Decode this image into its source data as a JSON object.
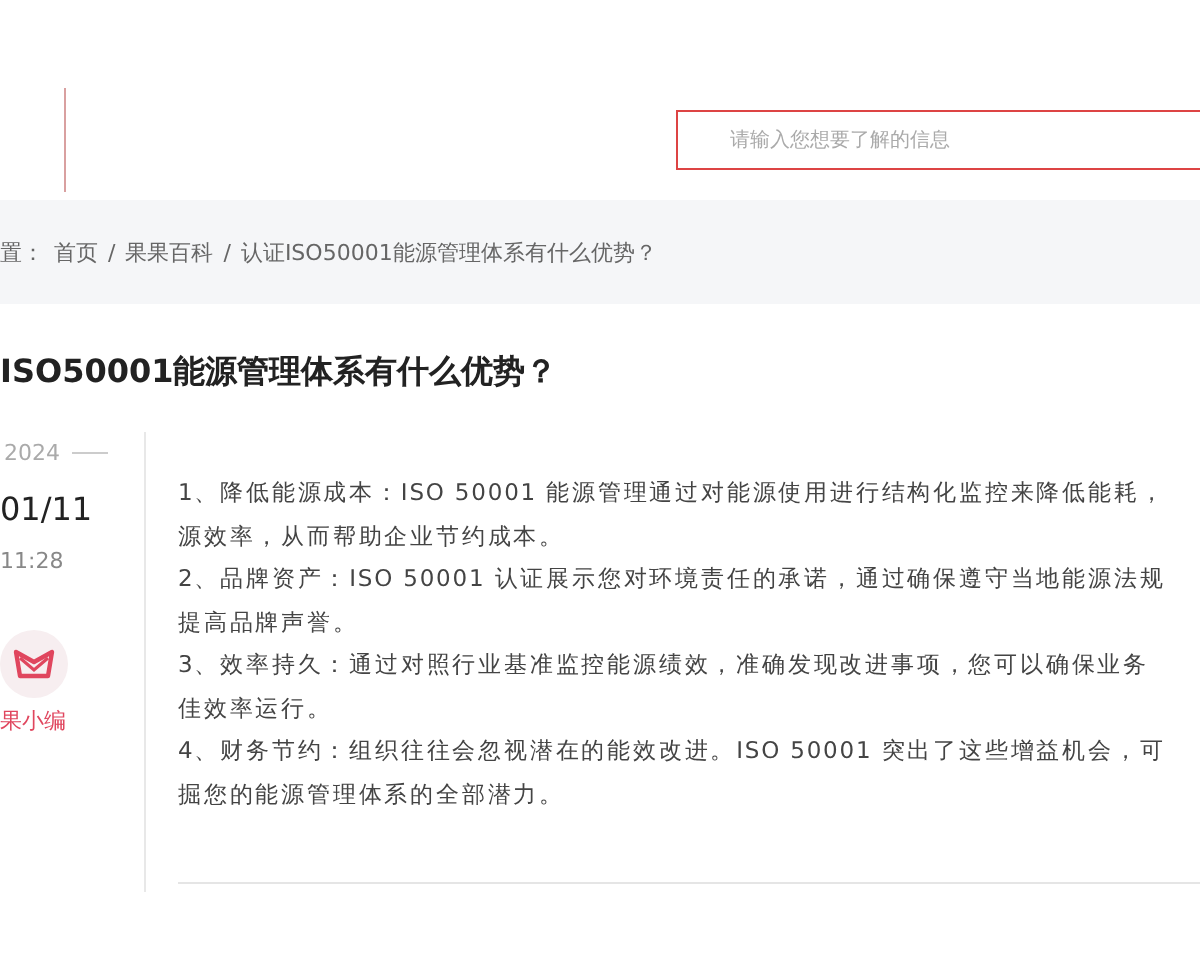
{
  "search": {
    "placeholder": "请输入您想要了解的信息"
  },
  "breadcrumb": {
    "prefix": "置：",
    "items": [
      {
        "label": "首页"
      },
      {
        "label": "果果百科"
      },
      {
        "label": "认证ISO50001能源管理体系有什么优势？"
      }
    ],
    "separator": "/"
  },
  "article": {
    "title": "ISO50001能源管理体系有什么优势？",
    "meta": {
      "year": "2024",
      "date": "01/11",
      "time": "11:28",
      "author": "果小编"
    },
    "lines": [
      "1、降低能源成本：ISO 50001 能源管理通过对能源使用进行结构化监控来降低能耗，",
      "源效率，从而帮助企业节约成本。",
      "2、品牌资产：ISO 50001 认证展示您对环境责任的承诺，通过确保遵守当地能源法规",
      "提高品牌声誉。",
      "3、效率持久：通过对照行业基准监控能源绩效，准确发现改进事项，您可以确保业务",
      "佳效率运行。",
      "4、财务节约：组织往往会忽视潜在的能效改进。ISO 50001 突出了这些增益机会，可",
      "掘您的能源管理体系的全部潜力。"
    ]
  }
}
